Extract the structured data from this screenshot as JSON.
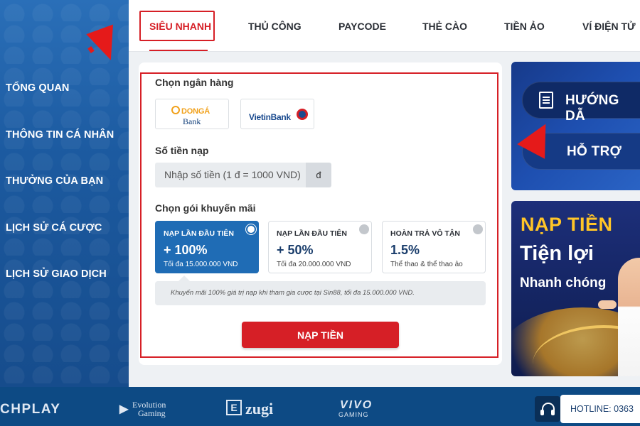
{
  "sidebar": {
    "items": [
      {
        "label": "TỔNG QUAN"
      },
      {
        "label": "THÔNG TIN CÁ NHÂN"
      },
      {
        "label": "THƯỞNG CỦA BẠN"
      },
      {
        "label": "LỊCH SỬ CÁ CƯỢC"
      },
      {
        "label": "LỊCH SỬ GIAO DỊCH"
      }
    ]
  },
  "tabs": [
    {
      "label": "SIÊU NHANH",
      "active": true
    },
    {
      "label": "THỦ CÔNG"
    },
    {
      "label": "PAYCODE"
    },
    {
      "label": "THẺ CÀO"
    },
    {
      "label": "TIỀN ẢO"
    },
    {
      "label": "VÍ ĐIỆN TỬ"
    }
  ],
  "deposit": {
    "bank_label": "Chọn ngân hàng",
    "banks": [
      {
        "name_line1": "DONGÁ",
        "name_line2": "Bank"
      },
      {
        "name": "VietinBank"
      }
    ],
    "amount_label": "Số tiền nạp",
    "amount_placeholder": "Nhập số tiền (1 đ = 1000 VND)",
    "amount_unit": "đ",
    "promo_label": "Chọn gói khuyến mãi",
    "promos": [
      {
        "title": "NẠP LẦN ĐẦU TIÊN",
        "value": "+ 100%",
        "sub": "Tối đa 15.000.000 VND",
        "selected": true
      },
      {
        "title": "NẠP LẦN ĐẦU TIÊN",
        "value": "+ 50%",
        "sub": "Tối đa 20.000.000 VND",
        "selected": false
      },
      {
        "title": "HOÀN TRẢ VÔ TẬN",
        "value": "1.5%",
        "sub": "Thể thao & thể thao ảo",
        "selected": false
      }
    ],
    "promo_note": "Khuyến mãi 100% giá trị nạp khi tham gia cược tại Sin88, tối đa 15.000.000 VND.",
    "submit_label": "NẠP TIỀN"
  },
  "banner_help": {
    "guide_label": "HƯỚNG DẪ",
    "support_label": "HỖ TRỢ"
  },
  "banner_promo": {
    "line1": "NẠP TIỀN",
    "line2": "Tiện lợi",
    "line3": "Nhanh chóng"
  },
  "footer": {
    "partners": [
      "CHPLAY",
      "Evolution",
      "Gaming",
      "zugi",
      "VIVO",
      "GAMING"
    ],
    "hotline": "HOTLINE: 0363"
  },
  "colors": {
    "accent": "#d61f26",
    "sidebar": "#1c5aa0",
    "footer": "#0d4a84",
    "promo_active": "#1f6cb5"
  }
}
